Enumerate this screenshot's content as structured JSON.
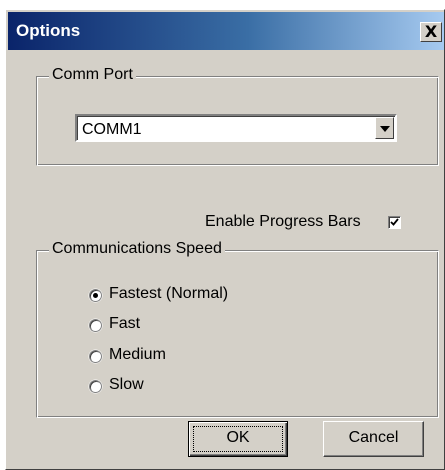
{
  "window": {
    "title": "Options",
    "close_glyph": "X"
  },
  "comm_port": {
    "group_label": "Comm Port",
    "selected_value": "COMM1"
  },
  "enable_progress_bars": {
    "label": "Enable Progress Bars",
    "checked": true
  },
  "communications_speed": {
    "group_label": "Communications Speed",
    "options": [
      {
        "label": "Fastest (Normal)",
        "selected": true
      },
      {
        "label": "Fast",
        "selected": false
      },
      {
        "label": "Medium",
        "selected": false
      },
      {
        "label": "Slow",
        "selected": false
      }
    ]
  },
  "buttons": {
    "ok_label": "OK",
    "cancel_label": "Cancel"
  },
  "colors": {
    "titlebar_start": "#0a246a",
    "titlebar_end": "#a6caf0",
    "dialog_face": "#d4d0c8"
  }
}
